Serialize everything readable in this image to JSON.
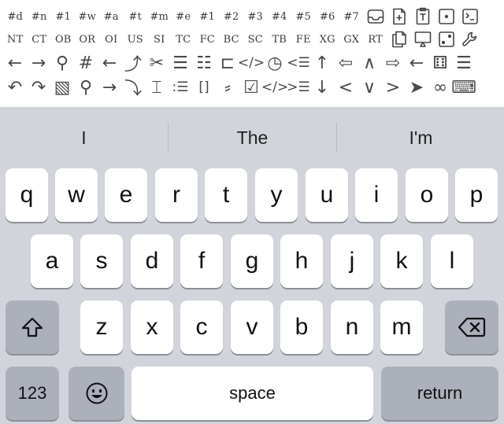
{
  "toolbar": {
    "row0": [
      "#d",
      "#n",
      "#1",
      "#w",
      "#a",
      "#t",
      "#m",
      "#e",
      "#1",
      "#2",
      "#3",
      "#4",
      "#5",
      "#6",
      "#7"
    ],
    "row1": [
      "NT",
      "CT",
      "OB",
      "OR",
      "OI",
      "US",
      "SI",
      "TC",
      "FC",
      "BC",
      "SC",
      "TB",
      "FE",
      "XG",
      "GX",
      "RT"
    ],
    "row2": [
      "←",
      "→",
      "⚲",
      "#",
      "←",
      "⤴",
      "✂",
      "☰",
      "☷",
      "⊏",
      "</>",
      "◷",
      "<☰",
      "↑",
      "⇦",
      "∧",
      "⇨",
      "←",
      "⚅",
      "☰"
    ],
    "row3": [
      "↶",
      "↷",
      "▧",
      "⚲",
      "→",
      "⤵",
      "⌶",
      ":☰",
      "[]",
      "⸗",
      "☑",
      "</>",
      ">☰",
      "↓",
      "<",
      "∨",
      ">",
      "➤",
      "∞",
      "⌨"
    ]
  },
  "keyboard": {
    "suggestions": [
      "I",
      "The",
      "I'm"
    ],
    "row1": [
      "q",
      "w",
      "e",
      "r",
      "t",
      "y",
      "u",
      "i",
      "o",
      "p"
    ],
    "row2": [
      "a",
      "s",
      "d",
      "f",
      "g",
      "h",
      "j",
      "k",
      "l"
    ],
    "row3": [
      "z",
      "x",
      "c",
      "v",
      "b",
      "n",
      "m"
    ],
    "numbers_label": "123",
    "space_label": "space",
    "return_label": "return"
  },
  "icons": {
    "row0": [
      "inbox-tray-icon",
      "add-file-icon",
      "text-file-icon",
      "dot-square-icon",
      "terminal-icon"
    ],
    "row1": [
      "copy-file-icon",
      "present-screen-icon",
      "dice-icon",
      "wrench-icon"
    ]
  },
  "colors": {
    "keyboard_bg": "#d1d4da",
    "key_bg": "#ffffff",
    "special_key_bg": "#abb0bb"
  }
}
